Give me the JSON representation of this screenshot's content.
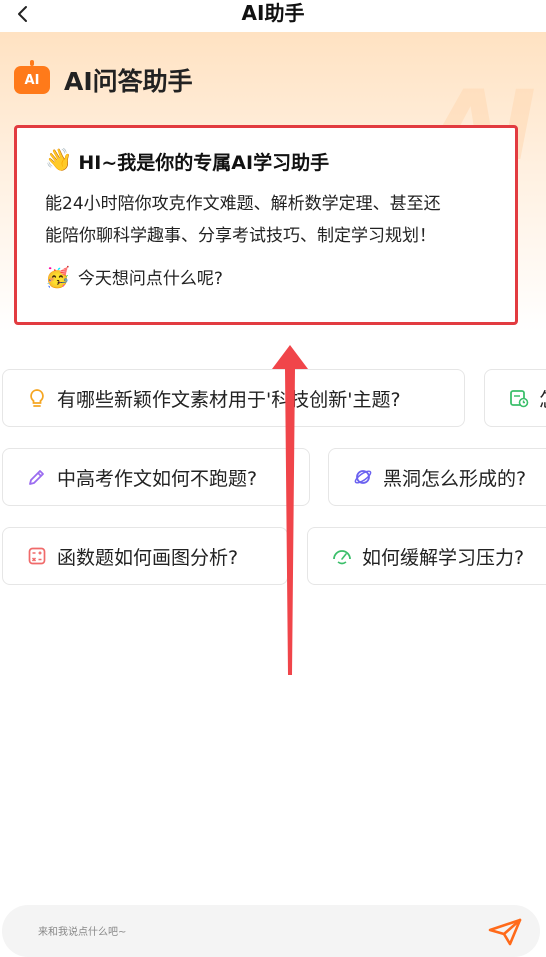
{
  "nav": {
    "title": "AI助手"
  },
  "brand": {
    "logo_text": "AI",
    "name": "AI问答助手",
    "watermark": "AI"
  },
  "greeting": {
    "title": "HI~我是你的专属AI学习助手",
    "body_line1": "能24小时陪你攻克作文难题、解析数学定理、甚至还",
    "body_line2": "能陪你聊科学趣事、分享考试技巧、制定学习规划！",
    "question": "今天想问点什么呢?"
  },
  "suggestions": [
    {
      "label": "有哪些新颖作文素材用于'科技创新'主题?",
      "icon": "lightbulb-icon",
      "color": "#f5a623"
    },
    {
      "label": "怎",
      "icon": "calendar-clock-icon",
      "color": "#3cbf6b"
    },
    {
      "label": "中高考作文如何不跑题?",
      "icon": "pencil-icon",
      "color": "#9b6cf0"
    },
    {
      "label": "黑洞怎么形成的?",
      "icon": "planet-icon",
      "color": "#6b62f0"
    },
    {
      "label": "函数题如何画图分析?",
      "icon": "calculator-icon",
      "color": "#f06a6a"
    },
    {
      "label": "如何缓解学习压力?",
      "icon": "smile-gauge-icon",
      "color": "#3cbf6b"
    }
  ],
  "input": {
    "placeholder": "来和我说点什么吧~"
  },
  "colors": {
    "accent": "#ff7a1a",
    "highlight_border": "#e23b40",
    "send": "#ff6a1a"
  }
}
